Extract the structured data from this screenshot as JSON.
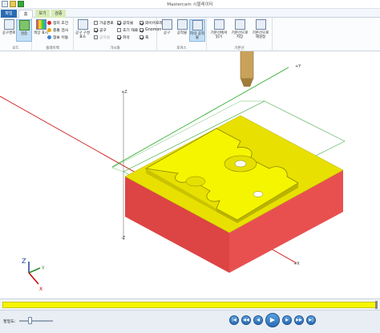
{
  "window": {
    "title": "Mastercam 시뮬레이터",
    "context_tab": "검증"
  },
  "tabs": [
    {
      "label": "파일"
    },
    {
      "label": "홈"
    },
    {
      "label": "보기"
    },
    {
      "label": "검증"
    }
  ],
  "ribbon": {
    "groups": {
      "mode": {
        "label": "모드",
        "buttons": [
          {
            "label": "공구경로",
            "icon": "toolpath-icon"
          },
          {
            "label": "검증",
            "icon": "verify-icon"
          }
        ]
      },
      "playback": {
        "label": "플레이백",
        "big": {
          "label": "색상 표시",
          "icon": "color-icon"
        },
        "items": [
          {
            "label": "정지 조건",
            "icon": "stop-condition-icon"
          },
          {
            "label": "충돌 검사",
            "icon": "collision-icon"
          },
          {
            "label": "정보 이동",
            "icon": "info-move-icon"
          }
        ]
      },
      "visibility": {
        "label": "가시화",
        "big": {
          "label": "공구 구성 표소",
          "icon": "tool-config-icon"
        },
        "checkboxes": [
          {
            "label": "가공경로",
            "checked": false
          },
          {
            "label": "공구",
            "checked": true
          },
          {
            "label": "공작물",
            "checked": false
          },
          {
            "label": "공작물",
            "checked": true
          },
          {
            "label": "초기 재료",
            "checked": false
          },
          {
            "label": "피삭",
            "checked": true
          },
          {
            "label": "와이어프레임",
            "checked": true
          },
          {
            "label": "Gnomon",
            "checked": true
          },
          {
            "label": "축",
            "checked": true
          }
        ]
      },
      "focus": {
        "label": "포커스",
        "buttons": [
          {
            "label": "공구",
            "icon": "tool-focus-icon"
          },
          {
            "label": "공작물",
            "icon": "workpiece-focus-icon"
          },
          {
            "label": "피삭 공작물",
            "icon": "stock-focus-icon"
          }
        ]
      },
      "baseline": {
        "label": "기본선",
        "buttons": [
          {
            "label": "기본선에서 읽기",
            "icon": "baseline-read-icon"
          },
          {
            "label": "기본선으로 저장",
            "icon": "baseline-save-icon"
          },
          {
            "label": "기본선으로 재설정",
            "icon": "baseline-reset-icon"
          }
        ]
      }
    }
  },
  "viewport": {
    "axis_labels": {
      "z": "Z",
      "y": "Y",
      "x": "X"
    },
    "tick_plus": "+Z",
    "tick_minus": "-Z",
    "right_label": "+Y",
    "bottom_label": "+X",
    "colors": {
      "part_top": "#f5f500",
      "part_side": "#e02a2a",
      "axis_red": "#cc0000",
      "axis_green": "#22aa22"
    }
  },
  "status": {
    "speed_label": "정밀도:",
    "speed_value": 0.3,
    "progress": 1.0,
    "controls": [
      {
        "name": "first-button",
        "glyph": "|◀"
      },
      {
        "name": "step-back-button",
        "glyph": "◀◀"
      },
      {
        "name": "back-button",
        "glyph": "◀"
      },
      {
        "name": "play-button",
        "glyph": "▶"
      },
      {
        "name": "forward-button",
        "glyph": "▶"
      },
      {
        "name": "step-forward-button",
        "glyph": "▶▶"
      },
      {
        "name": "last-button",
        "glyph": "▶|"
      }
    ]
  }
}
